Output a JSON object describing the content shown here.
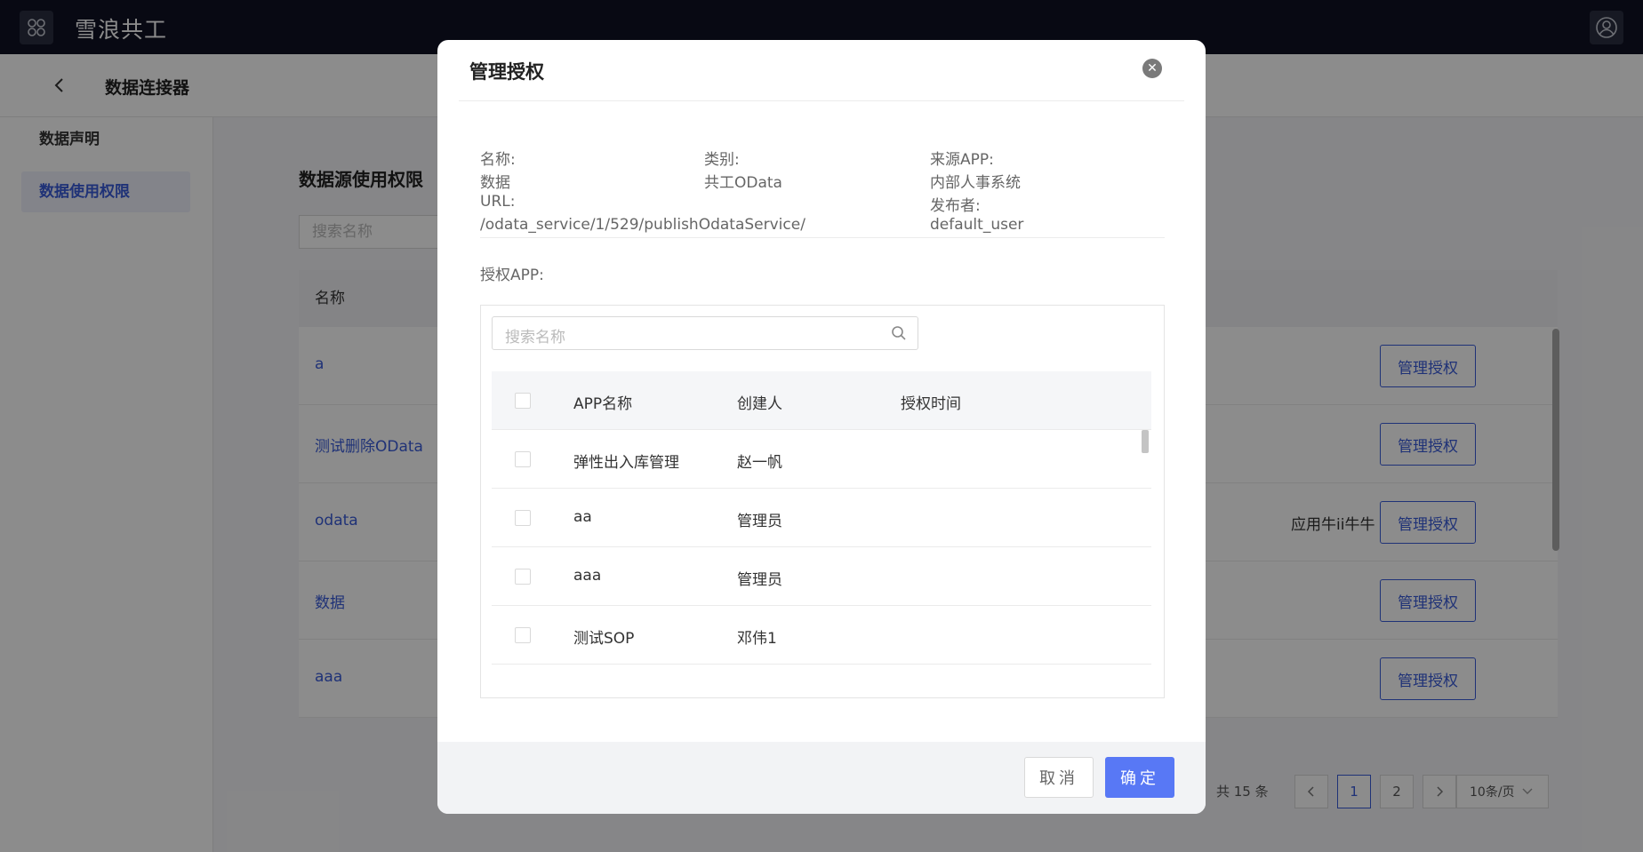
{
  "app": {
    "title": "雪浪共工"
  },
  "header": {
    "page_title": "数据连接器"
  },
  "sidebar": {
    "items": [
      {
        "label": "数据声明"
      },
      {
        "label": "数据使用权限"
      }
    ]
  },
  "main": {
    "section_title": "数据源使用权限",
    "search_placeholder": "搜索名称",
    "table": {
      "name_header": "名称",
      "rows": [
        {
          "name": "a",
          "desc": "",
          "action": "管理授权"
        },
        {
          "name": "测试删除OData",
          "desc": "",
          "action": "管理授权"
        },
        {
          "name": "odata",
          "desc": "应用牛ii牛牛",
          "action": "管理授权"
        },
        {
          "name": "数据",
          "desc": "",
          "action": "管理授权"
        },
        {
          "name": "aaa",
          "desc": "",
          "action": "管理授权"
        }
      ]
    },
    "pagination": {
      "total": "共 15 条",
      "pages": [
        "1",
        "2"
      ],
      "current": "1",
      "page_size": "10条/页"
    }
  },
  "modal": {
    "title": "管理授权",
    "info": {
      "name_label": "名称:",
      "name_value": "数据",
      "type_label": "类别:",
      "type_value": "共工OData",
      "source_label": "来源APP:",
      "source_value": "内部人事系统",
      "url_label": "URL:",
      "url_value": "/odata_service/1/529/publishOdataService/",
      "publisher_label": "发布者:",
      "publisher_value": "default_user"
    },
    "auth_label": "授权APP:",
    "search_placeholder": "搜索名称",
    "table": {
      "headers": {
        "app_name": "APP名称",
        "creator": "创建人",
        "auth_time": "授权时间"
      },
      "rows": [
        {
          "app_name": "弹性出入库管理",
          "creator": "赵一帆",
          "auth_time": ""
        },
        {
          "app_name": "aa",
          "creator": "管理员",
          "auth_time": ""
        },
        {
          "app_name": "aaa",
          "creator": "管理员",
          "auth_time": ""
        },
        {
          "app_name": "测试SOP",
          "creator": "邓伟1",
          "auth_time": ""
        }
      ]
    },
    "footer": {
      "cancel": "取消",
      "ok": "确定"
    }
  }
}
